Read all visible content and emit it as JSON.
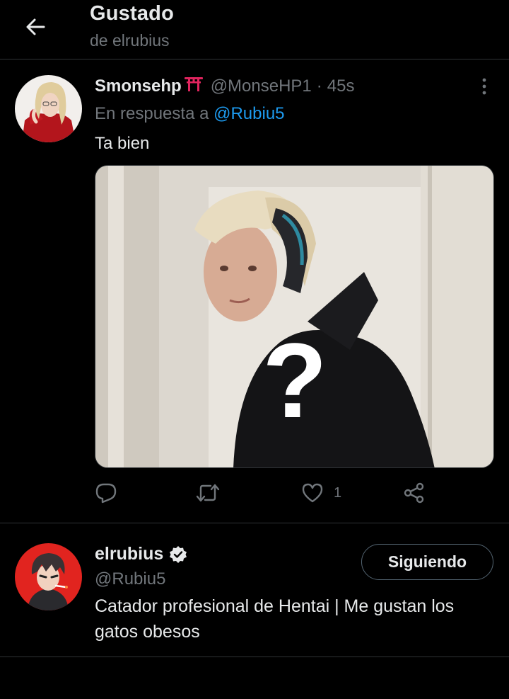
{
  "header": {
    "title": "Gustado",
    "subtitle": "de elrubius"
  },
  "tweet": {
    "author_name": "Smonsehp",
    "author_emoji": "torii-gate",
    "author_handle": "@MonseHP1",
    "separator": "·",
    "time": "45s",
    "reply_prefix": "En respuesta a",
    "reply_mention": "@Rubiu5",
    "text": "Ta bien",
    "media": {
      "description_icon": "question-mark",
      "overlay_glyph": "?"
    },
    "actions": {
      "reply_icon": "reply-icon",
      "retweet_icon": "retweet-icon",
      "like_icon": "heart-icon",
      "like_count": "1",
      "share_icon": "share-icon"
    }
  },
  "profile": {
    "name": "elrubius",
    "handle": "@Rubiu5",
    "follow_label": "Siguiendo",
    "bio": "Catador profesional de Hentai | Me gustan los gatos obesos"
  },
  "colors": {
    "background": "#000000",
    "text_primary": "#e7e9ea",
    "text_secondary": "#71767b",
    "accent": "#1d9bf0",
    "divider": "#2f3336",
    "verified": "#e7e9ea"
  }
}
